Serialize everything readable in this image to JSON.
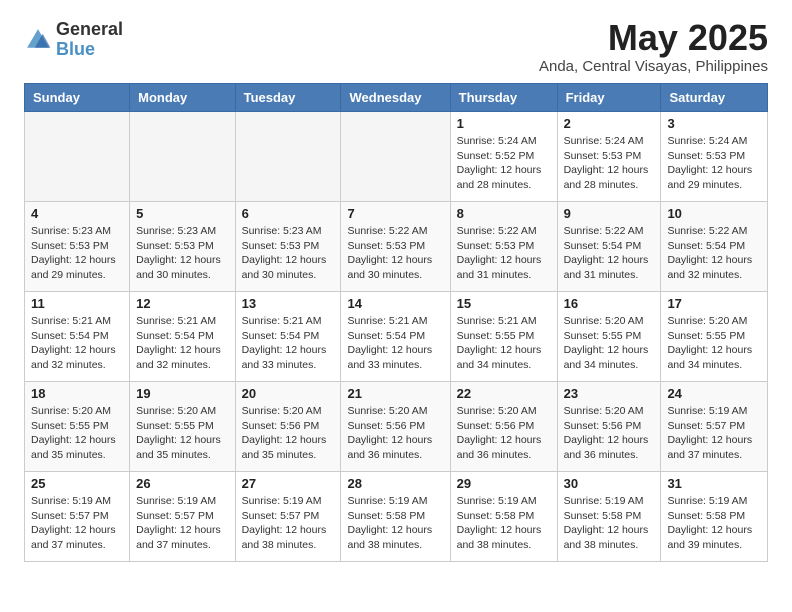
{
  "logo": {
    "general": "General",
    "blue": "Blue"
  },
  "title": "May 2025",
  "location": "Anda, Central Visayas, Philippines",
  "days_of_week": [
    "Sunday",
    "Monday",
    "Tuesday",
    "Wednesday",
    "Thursday",
    "Friday",
    "Saturday"
  ],
  "weeks": [
    [
      {
        "day": "",
        "info": ""
      },
      {
        "day": "",
        "info": ""
      },
      {
        "day": "",
        "info": ""
      },
      {
        "day": "",
        "info": ""
      },
      {
        "day": "1",
        "info": "Sunrise: 5:24 AM\nSunset: 5:52 PM\nDaylight: 12 hours\nand 28 minutes."
      },
      {
        "day": "2",
        "info": "Sunrise: 5:24 AM\nSunset: 5:53 PM\nDaylight: 12 hours\nand 28 minutes."
      },
      {
        "day": "3",
        "info": "Sunrise: 5:24 AM\nSunset: 5:53 PM\nDaylight: 12 hours\nand 29 minutes."
      }
    ],
    [
      {
        "day": "4",
        "info": "Sunrise: 5:23 AM\nSunset: 5:53 PM\nDaylight: 12 hours\nand 29 minutes."
      },
      {
        "day": "5",
        "info": "Sunrise: 5:23 AM\nSunset: 5:53 PM\nDaylight: 12 hours\nand 30 minutes."
      },
      {
        "day": "6",
        "info": "Sunrise: 5:23 AM\nSunset: 5:53 PM\nDaylight: 12 hours\nand 30 minutes."
      },
      {
        "day": "7",
        "info": "Sunrise: 5:22 AM\nSunset: 5:53 PM\nDaylight: 12 hours\nand 30 minutes."
      },
      {
        "day": "8",
        "info": "Sunrise: 5:22 AM\nSunset: 5:53 PM\nDaylight: 12 hours\nand 31 minutes."
      },
      {
        "day": "9",
        "info": "Sunrise: 5:22 AM\nSunset: 5:54 PM\nDaylight: 12 hours\nand 31 minutes."
      },
      {
        "day": "10",
        "info": "Sunrise: 5:22 AM\nSunset: 5:54 PM\nDaylight: 12 hours\nand 32 minutes."
      }
    ],
    [
      {
        "day": "11",
        "info": "Sunrise: 5:21 AM\nSunset: 5:54 PM\nDaylight: 12 hours\nand 32 minutes."
      },
      {
        "day": "12",
        "info": "Sunrise: 5:21 AM\nSunset: 5:54 PM\nDaylight: 12 hours\nand 32 minutes."
      },
      {
        "day": "13",
        "info": "Sunrise: 5:21 AM\nSunset: 5:54 PM\nDaylight: 12 hours\nand 33 minutes."
      },
      {
        "day": "14",
        "info": "Sunrise: 5:21 AM\nSunset: 5:54 PM\nDaylight: 12 hours\nand 33 minutes."
      },
      {
        "day": "15",
        "info": "Sunrise: 5:21 AM\nSunset: 5:55 PM\nDaylight: 12 hours\nand 34 minutes."
      },
      {
        "day": "16",
        "info": "Sunrise: 5:20 AM\nSunset: 5:55 PM\nDaylight: 12 hours\nand 34 minutes."
      },
      {
        "day": "17",
        "info": "Sunrise: 5:20 AM\nSunset: 5:55 PM\nDaylight: 12 hours\nand 34 minutes."
      }
    ],
    [
      {
        "day": "18",
        "info": "Sunrise: 5:20 AM\nSunset: 5:55 PM\nDaylight: 12 hours\nand 35 minutes."
      },
      {
        "day": "19",
        "info": "Sunrise: 5:20 AM\nSunset: 5:55 PM\nDaylight: 12 hours\nand 35 minutes."
      },
      {
        "day": "20",
        "info": "Sunrise: 5:20 AM\nSunset: 5:56 PM\nDaylight: 12 hours\nand 35 minutes."
      },
      {
        "day": "21",
        "info": "Sunrise: 5:20 AM\nSunset: 5:56 PM\nDaylight: 12 hours\nand 36 minutes."
      },
      {
        "day": "22",
        "info": "Sunrise: 5:20 AM\nSunset: 5:56 PM\nDaylight: 12 hours\nand 36 minutes."
      },
      {
        "day": "23",
        "info": "Sunrise: 5:20 AM\nSunset: 5:56 PM\nDaylight: 12 hours\nand 36 minutes."
      },
      {
        "day": "24",
        "info": "Sunrise: 5:19 AM\nSunset: 5:57 PM\nDaylight: 12 hours\nand 37 minutes."
      }
    ],
    [
      {
        "day": "25",
        "info": "Sunrise: 5:19 AM\nSunset: 5:57 PM\nDaylight: 12 hours\nand 37 minutes."
      },
      {
        "day": "26",
        "info": "Sunrise: 5:19 AM\nSunset: 5:57 PM\nDaylight: 12 hours\nand 37 minutes."
      },
      {
        "day": "27",
        "info": "Sunrise: 5:19 AM\nSunset: 5:57 PM\nDaylight: 12 hours\nand 38 minutes."
      },
      {
        "day": "28",
        "info": "Sunrise: 5:19 AM\nSunset: 5:58 PM\nDaylight: 12 hours\nand 38 minutes."
      },
      {
        "day": "29",
        "info": "Sunrise: 5:19 AM\nSunset: 5:58 PM\nDaylight: 12 hours\nand 38 minutes."
      },
      {
        "day": "30",
        "info": "Sunrise: 5:19 AM\nSunset: 5:58 PM\nDaylight: 12 hours\nand 38 minutes."
      },
      {
        "day": "31",
        "info": "Sunrise: 5:19 AM\nSunset: 5:58 PM\nDaylight: 12 hours\nand 39 minutes."
      }
    ]
  ]
}
